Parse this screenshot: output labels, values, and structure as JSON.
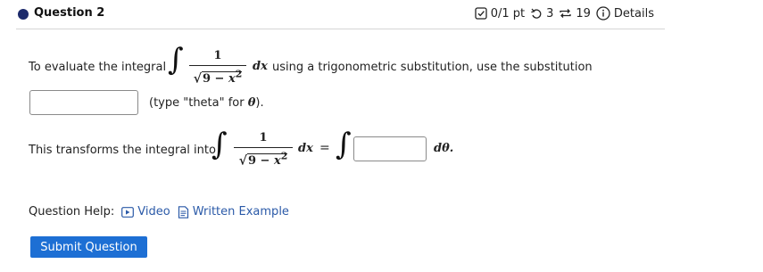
{
  "header": {
    "title": "Question 2",
    "score": "0/1 pt",
    "retries": "3",
    "attempts": "19",
    "details": "Details"
  },
  "question": {
    "intro": "To evaluate the integral",
    "integrand_num": "1",
    "integrand_den_prefix": "9 − ",
    "integrand_den_var": "x",
    "integrand_den_exp": "2",
    "dx": "dx",
    "rest": "using a trigonometric substitution, use the substitution",
    "type_note": "(type \"theta\" for ",
    "theta": "θ",
    "type_note_end": ").",
    "transforms": "This transforms the integral into",
    "equals": "=",
    "dtheta": "dθ."
  },
  "inputs": {
    "substitution_value": "",
    "integrand_value": ""
  },
  "help": {
    "label": "Question Help:",
    "video": "Video",
    "written_example": "Written Example"
  },
  "submit_label": "Submit Question"
}
